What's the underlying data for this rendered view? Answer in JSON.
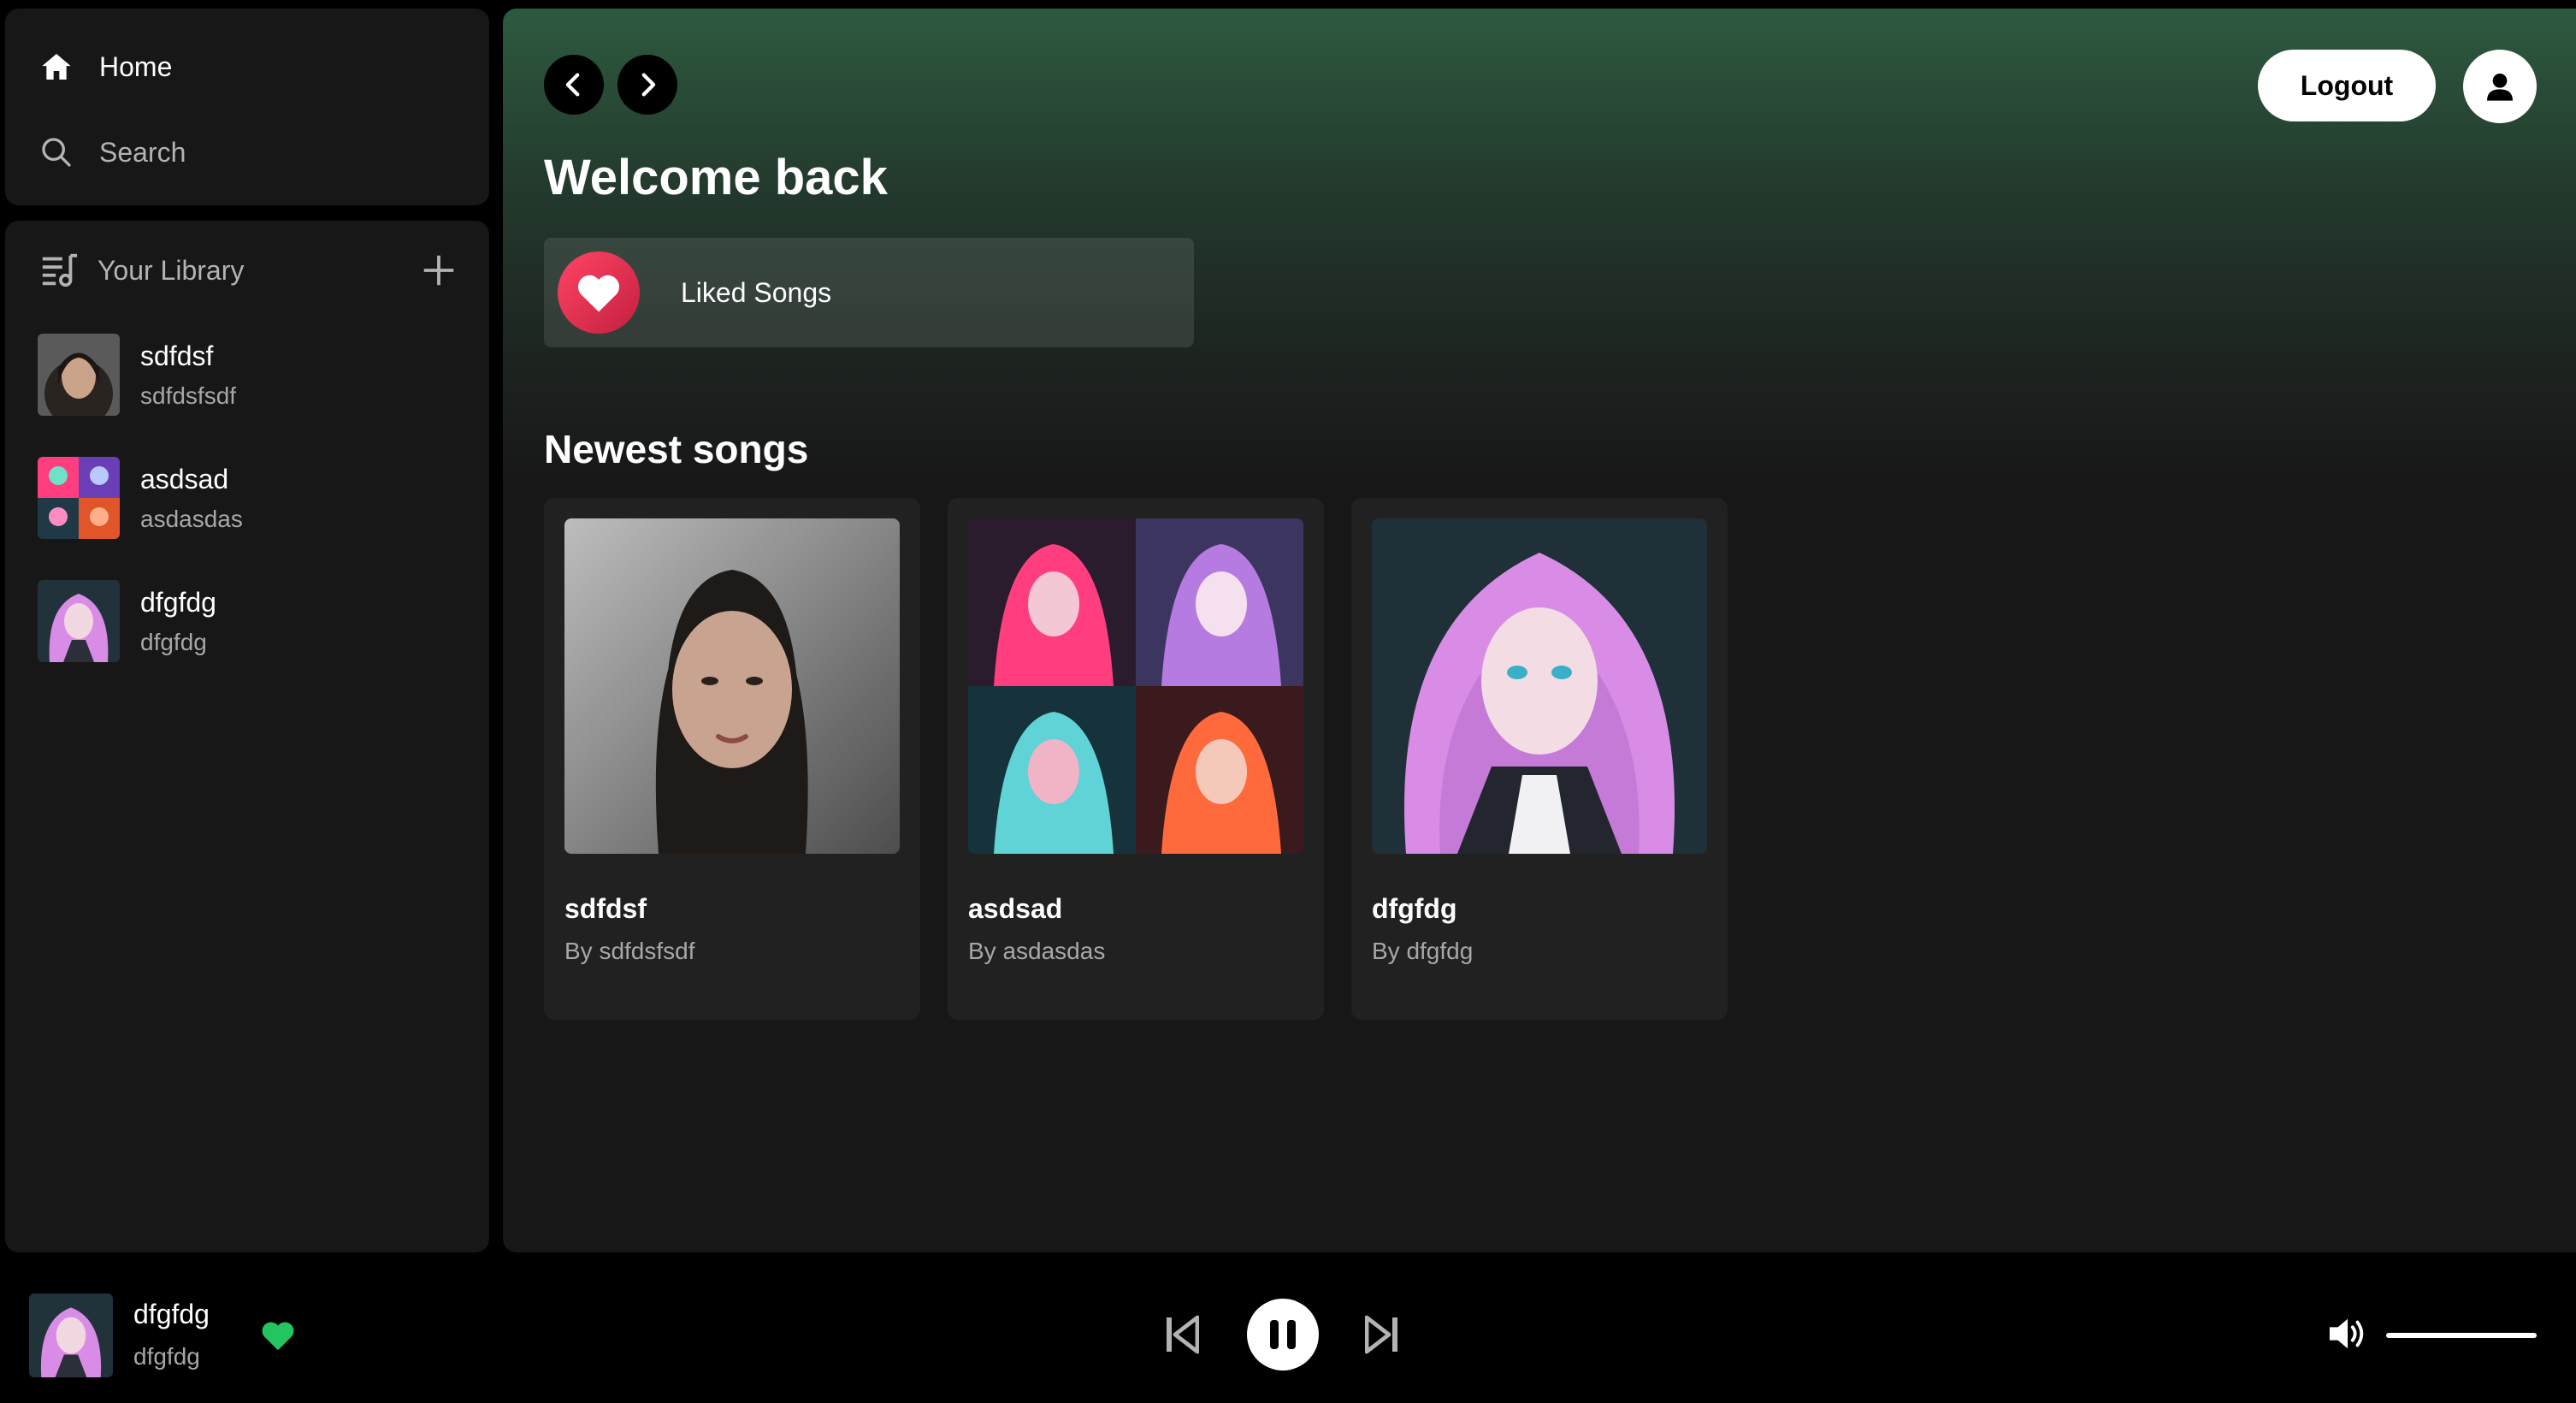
{
  "sidebar": {
    "nav": {
      "home_label": "Home",
      "search_label": "Search"
    },
    "library": {
      "title": "Your Library",
      "items": [
        {
          "title": "sdfdsf",
          "subtitle": "sdfdsfsdf",
          "art": "portrait-woman"
        },
        {
          "title": "asdsad",
          "subtitle": "asdasdas",
          "art": "anime-grid"
        },
        {
          "title": "dfgfdg",
          "subtitle": "dfgfdg",
          "art": "anime-girl"
        }
      ]
    }
  },
  "header": {
    "logout_label": "Logout",
    "welcome": "Welcome back"
  },
  "liked": {
    "label": "Liked Songs"
  },
  "newest": {
    "title": "Newest songs",
    "songs": [
      {
        "title": "sdfdsf",
        "artist": "By sdfdsfsdf",
        "art": "portrait-woman"
      },
      {
        "title": "asdsad",
        "artist": "By asdasdas",
        "art": "anime-grid"
      },
      {
        "title": "dfgfdg",
        "artist": "By dfgfdg",
        "art": "anime-girl"
      }
    ]
  },
  "player": {
    "title": "dfgfdg",
    "artist": "dfgfdg",
    "liked": true,
    "state": "playing",
    "volume": 1.0
  },
  "colors": {
    "accent": "#22c55e",
    "heart_red": "#e8334f",
    "header_green": "#2d5a3f"
  },
  "icons": [
    "home-icon",
    "search-icon",
    "library-icon",
    "plus-icon",
    "heart-icon",
    "chevron-left-icon",
    "chevron-right-icon",
    "user-icon",
    "skip-back-icon",
    "pause-icon",
    "skip-forward-icon",
    "volume-icon"
  ]
}
